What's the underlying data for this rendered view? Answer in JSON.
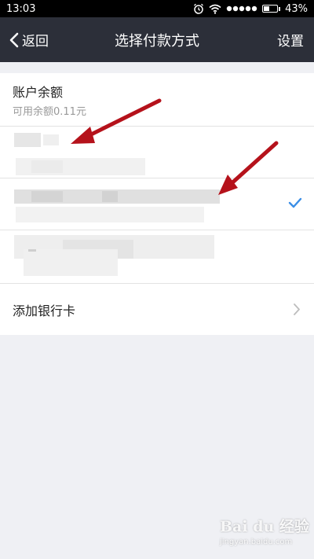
{
  "status_bar": {
    "time": "13:03",
    "battery_percent": "43%",
    "battery_level": 0.43,
    "icons": [
      "alarm-icon",
      "wifi-icon",
      "signal-dots-icon",
      "battery-icon"
    ]
  },
  "nav": {
    "back_label": "返回",
    "title": "选择付款方式",
    "settings_label": "设置"
  },
  "balance": {
    "title": "账户余额",
    "subtitle": "可用余额0.11元"
  },
  "payment_options": [
    {
      "label": "",
      "blurred": true
    },
    {
      "label": "",
      "blurred": true,
      "selected": true
    },
    {
      "label": "",
      "blurred": true
    }
  ],
  "add_card": {
    "label": "添加银行卡"
  },
  "watermark": {
    "logo": "Bai du 经验",
    "sub": "jingyan.baidu.com"
  },
  "colors": {
    "nav_bg": "#2c2f39",
    "page_bg": "#eff0f4",
    "check": "#3a8ee6",
    "annotation_arrow": "#b5121b"
  }
}
